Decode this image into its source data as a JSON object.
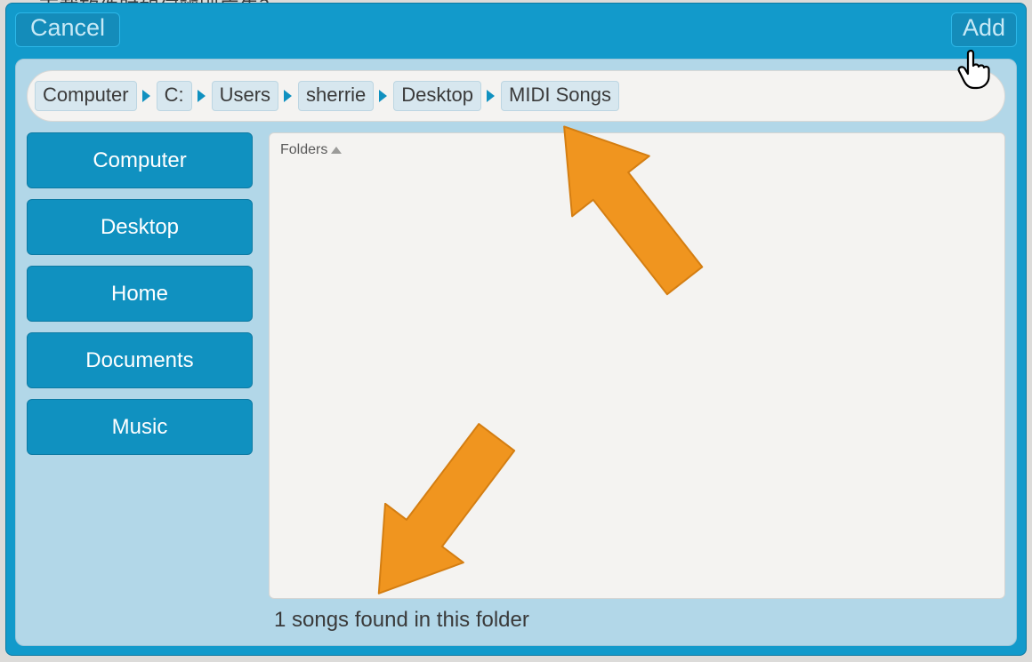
{
  "behind_text": "下载软件时如何辨别广告？",
  "header": {
    "cancel_label": "Cancel",
    "add_label": "Add"
  },
  "breadcrumb": {
    "items": [
      "Computer",
      "C:",
      "Users",
      "sherrie",
      "Desktop",
      "MIDI Songs"
    ]
  },
  "sidebar": {
    "items": [
      "Computer",
      "Desktop",
      "Home",
      "Documents",
      "Music"
    ]
  },
  "content": {
    "column_header": "Folders",
    "status": "1 songs found in this folder"
  }
}
